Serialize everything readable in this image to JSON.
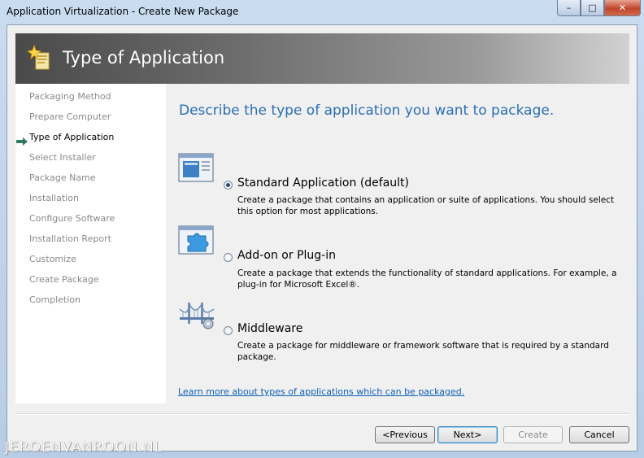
{
  "window": {
    "title": "Application Virtualization - Create New Package",
    "min_glyph": "–",
    "max_glyph": "□",
    "close_glyph": "✕"
  },
  "banner": {
    "title": "Type of Application"
  },
  "nav": {
    "items": [
      {
        "label": "Packaging Method",
        "active": false
      },
      {
        "label": "Prepare Computer",
        "active": false
      },
      {
        "label": "Type of Application",
        "active": true
      },
      {
        "label": "Select Installer",
        "active": false
      },
      {
        "label": "Package Name",
        "active": false
      },
      {
        "label": "Installation",
        "active": false
      },
      {
        "label": "Configure Software",
        "active": false
      },
      {
        "label": "Installation Report",
        "active": false
      },
      {
        "label": "Customize",
        "active": false
      },
      {
        "label": "Create Package",
        "active": false
      },
      {
        "label": "Completion",
        "active": false
      }
    ]
  },
  "main": {
    "heading": "Describe the type of application you want to package.",
    "options": [
      {
        "label": "Standard Application (default)",
        "description": "Create a package that contains an application or suite of applications. You should select this option for most applications.",
        "checked": true,
        "icon": "standard-application-icon"
      },
      {
        "label": "Add-on or Plug-in",
        "description": "Create a package that extends the functionality of standard applications. For example, a plug-in for Microsoft Excel®.",
        "checked": false,
        "icon": "puzzle-plugin-icon"
      },
      {
        "label": "Middleware",
        "description": "Create a package for middleware or framework software that is required by a standard package.",
        "checked": false,
        "icon": "bridge-middleware-icon"
      }
    ],
    "learn_more": "Learn more about types of applications which can be packaged."
  },
  "buttons": {
    "previous": "<Previous",
    "next": "Next>",
    "create": "Create",
    "cancel": "Cancel"
  },
  "watermark": "JEROENVANROON.NL",
  "colors": {
    "heading": "#2a6fb5",
    "link": "#0b5fb6",
    "active_arrow": "#2f7a5c"
  }
}
